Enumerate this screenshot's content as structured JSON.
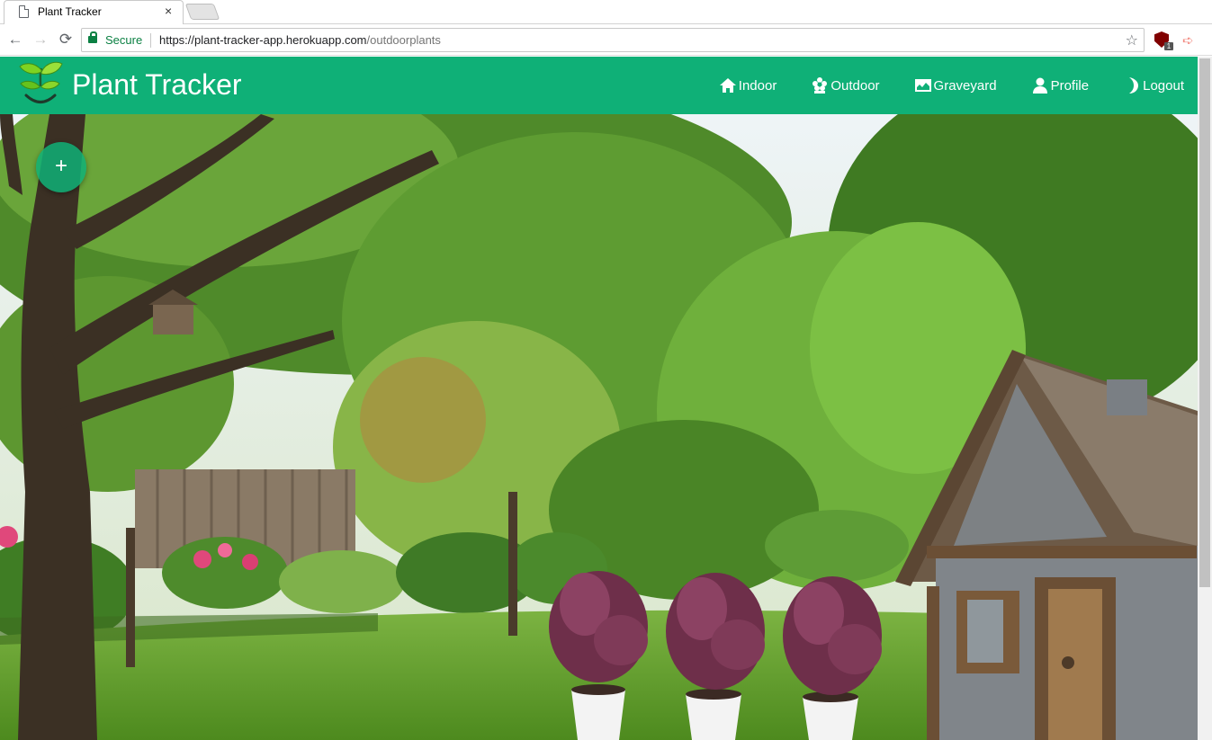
{
  "browser": {
    "tab_title": "Plant Tracker",
    "tab_close": "×",
    "back_glyph": "←",
    "forward_glyph": "→",
    "reload_glyph": "⟳",
    "secure_label": "Secure",
    "url_host": "https://plant-tracker-app.herokuapp.com",
    "url_path": "/outdoorplants",
    "bookmark_glyph": "☆",
    "extension_badge": "1",
    "extension_arrow": "➪"
  },
  "app": {
    "brand": "Plant Tracker",
    "brand_color": "#0fb077",
    "nav": [
      {
        "label": "Indoor",
        "icon": "home-icon"
      },
      {
        "label": "Outdoor",
        "icon": "flower-icon"
      },
      {
        "label": "Graveyard",
        "icon": "landscape-icon"
      },
      {
        "label": "Profile",
        "icon": "user-icon"
      },
      {
        "label": "Logout",
        "icon": "moon-icon"
      }
    ],
    "add_button_label": "+"
  },
  "scene": {
    "background": "garden-with-trees-fence-and-stone-cottage",
    "potted_plants": [
      {
        "name": "purple-leaf-plant"
      },
      {
        "name": "purple-leaf-plant"
      },
      {
        "name": "purple-leaf-plant"
      }
    ]
  }
}
